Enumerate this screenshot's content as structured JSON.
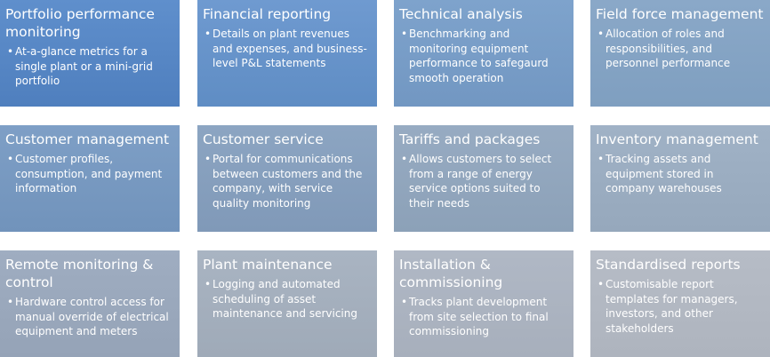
{
  "tiles": [
    {
      "title": "Portfolio performance monitoring",
      "desc": "At-a-glance metrics for a single plant or a mini-grid portfolio"
    },
    {
      "title": "Financial reporting",
      "desc": "Details on plant revenues and expenses, and business-level P&L statements"
    },
    {
      "title": "Technical analysis",
      "desc": "Benchmarking and  monitoring equipment performance to safegaurd smooth operation"
    },
    {
      "title": "Field force management",
      "desc": "Allocation of roles and responsibilities, and personnel performance"
    },
    {
      "title": "Customer management",
      "desc": "Customer profiles, consumption, and payment information"
    },
    {
      "title": "Customer service",
      "desc": "Portal for communications between customers and the company, with service quality monitoring"
    },
    {
      "title": "Tariffs and packages",
      "desc": "Allows customers to select from a range of energy service options suited to their needs"
    },
    {
      "title": "Inventory management",
      "desc": "Tracking assets and equipment stored in company warehouses"
    },
    {
      "title": "Remote monitoring & control",
      "desc": "Hardware control access for manual override of electrical equipment and meters"
    },
    {
      "title": "Plant maintenance",
      "desc": "Logging and automated scheduling of asset maintenance and servicing"
    },
    {
      "title": "Installation & commissioning",
      "desc": "Tracks plant development from site selection to final commissioning"
    },
    {
      "title": "Standardised reports",
      "desc": "Customisable report templates for managers, investors, and other stakeholders"
    }
  ]
}
